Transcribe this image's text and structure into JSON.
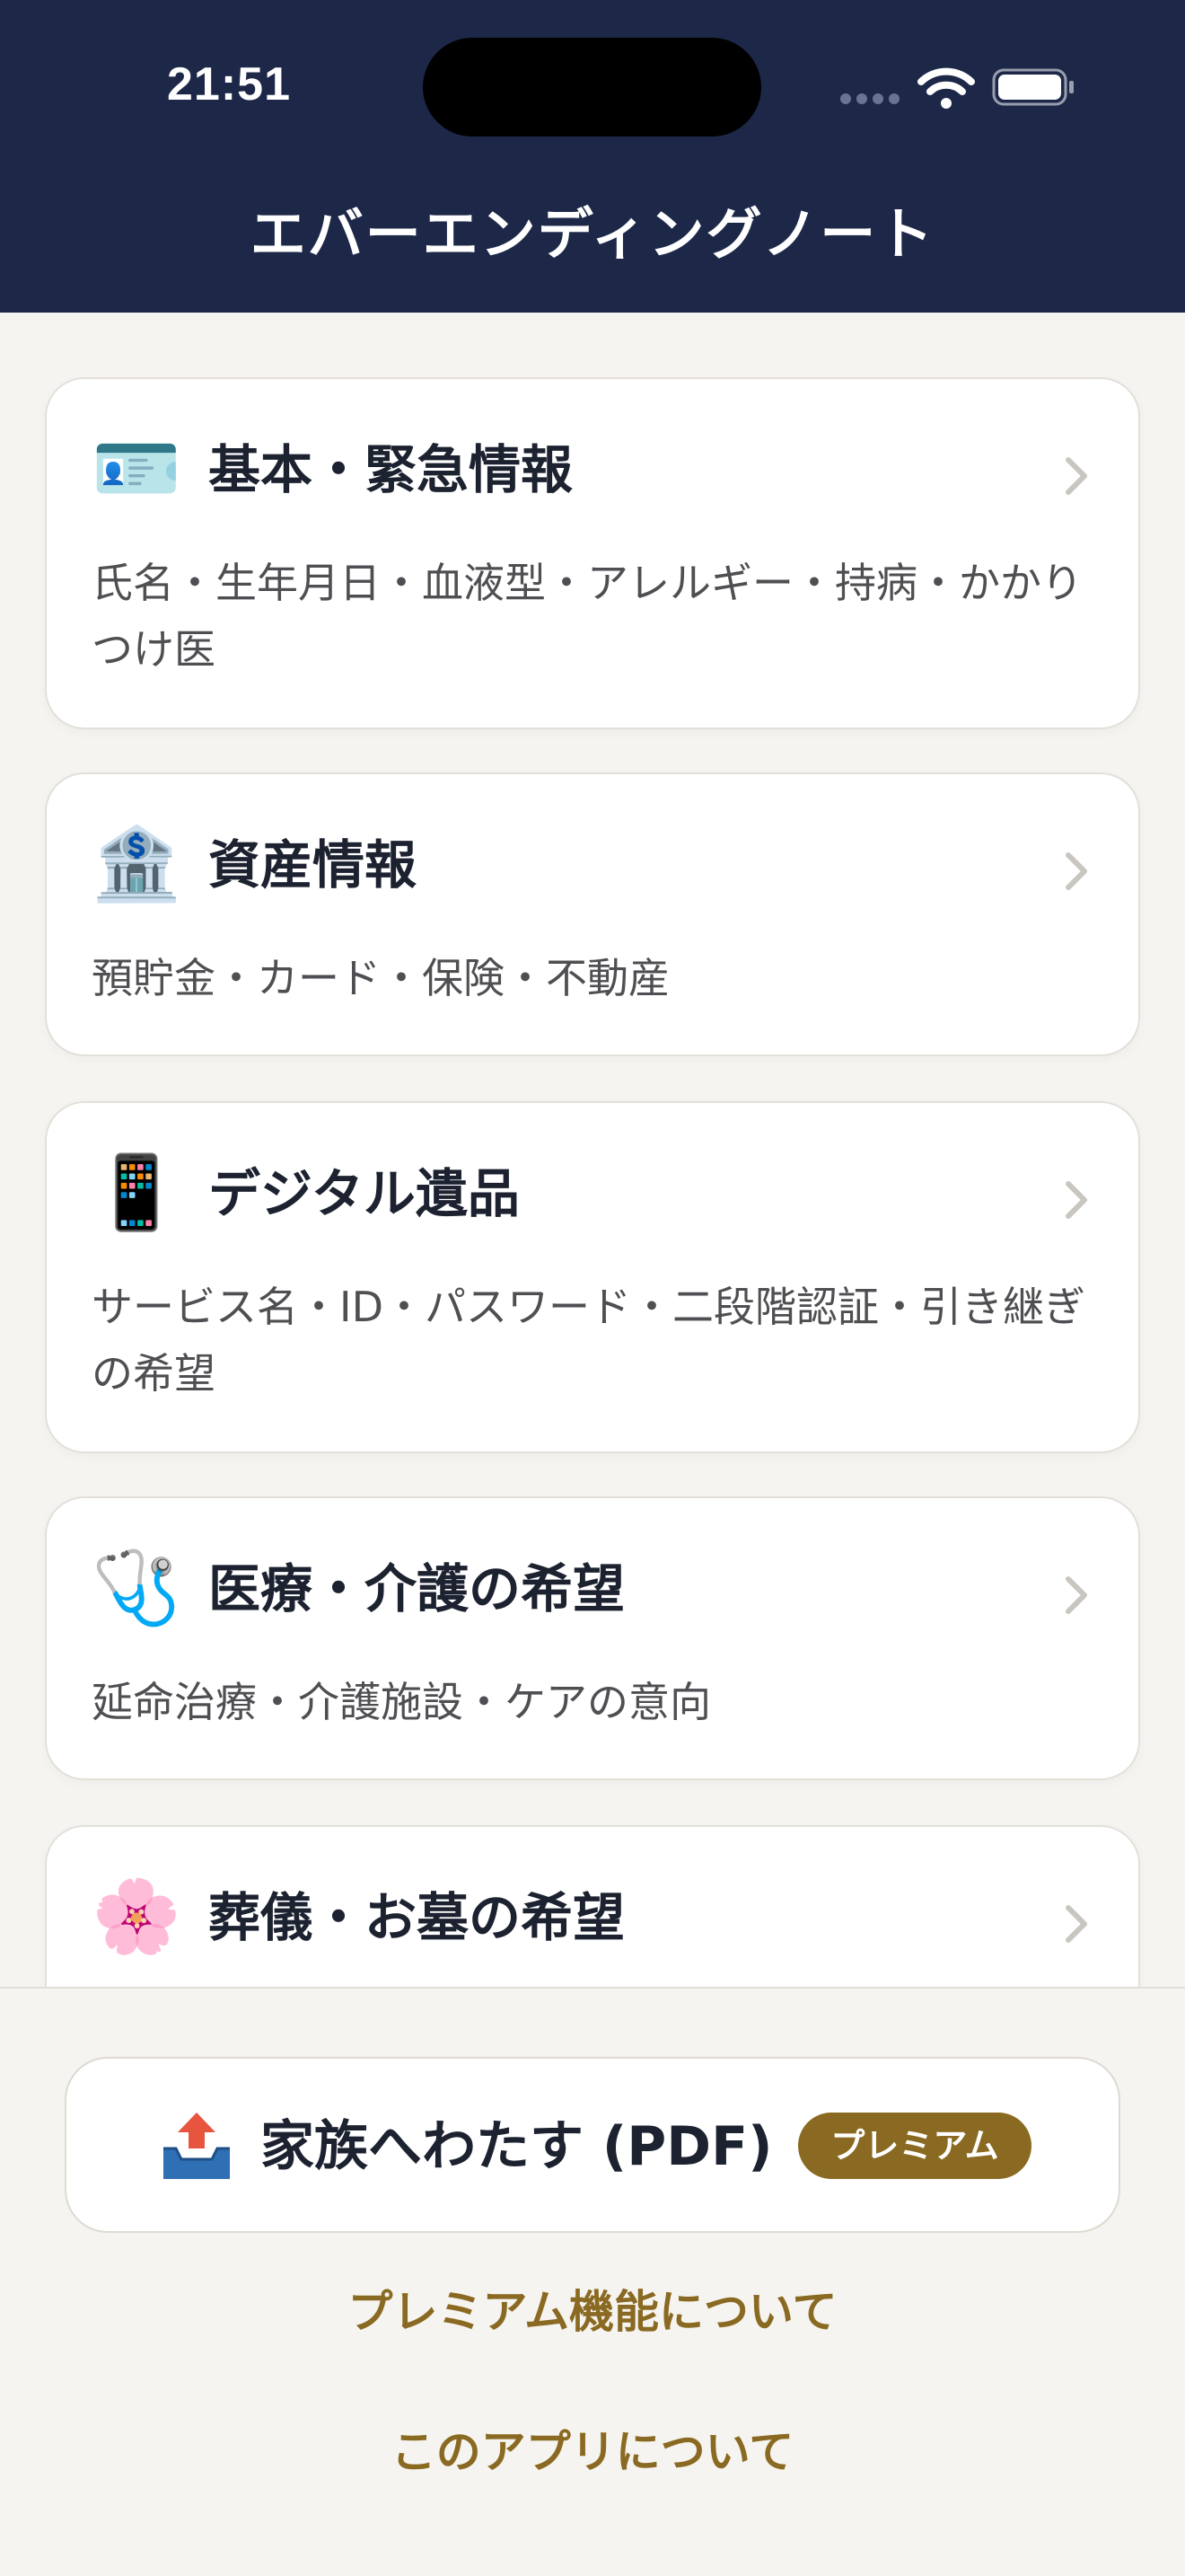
{
  "status_bar": {
    "time": "21:51"
  },
  "header": {
    "title": "エバーエンディングノート"
  },
  "cards": [
    {
      "icon": "id-card-icon",
      "emoji": "🪪",
      "title": "基本・緊急情報",
      "description": "氏名・生年月日・血液型・アレルギー・持病・かかりつけ医"
    },
    {
      "icon": "bank-icon",
      "emoji": "🏦",
      "title": "資産情報",
      "description": "預貯金・カード・保険・不動産"
    },
    {
      "icon": "mobile-phone-icon",
      "emoji": "📱",
      "title": "デジタル遺品",
      "description": "サービス名・ID・パスワード・二段階認証・引き継ぎの希望"
    },
    {
      "icon": "stethoscope-icon",
      "emoji": "🩺",
      "title": "医療・介護の希望",
      "description": "延命治療・介護施設・ケアの意向"
    },
    {
      "icon": "cherry-blossom-icon",
      "emoji": "🌸",
      "title": "葬儀・お墓の希望",
      "description": ""
    }
  ],
  "bottom": {
    "pdf_button_label": "家族へわたす (PDF)",
    "pdf_icon": "outbox-tray-icon",
    "premium_badge": "プレミアム",
    "premium_link": "プレミアム機能について",
    "about_link": "このアプリについて"
  },
  "colors": {
    "header_bg": "#1d2849",
    "page_bg": "#f6f4f0",
    "accent_gold": "#8a6a22",
    "chevron": "#c9c6c0"
  }
}
